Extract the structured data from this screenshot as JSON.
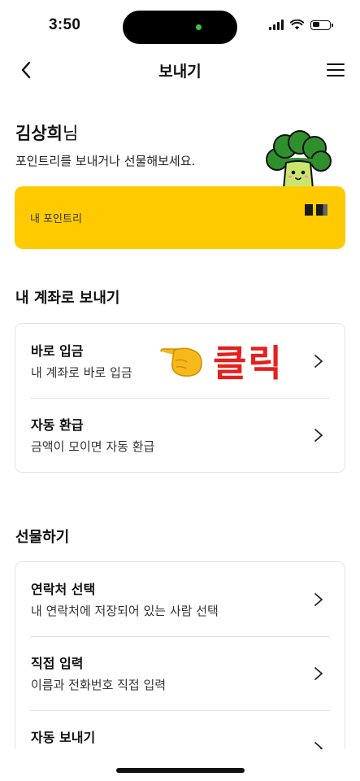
{
  "status_bar": {
    "time": "3:50"
  },
  "nav": {
    "title": "보내기"
  },
  "greeting": {
    "name": "김상희",
    "name_suffix": "님",
    "description": "포인트리를 보내거나 선물해보세요."
  },
  "points_card": {
    "label": "내 포인트리"
  },
  "section_my_account": {
    "title": "내 계좌로 보내기",
    "items": [
      {
        "title": "바로 입금",
        "subtitle": "내 계좌로 바로 입금"
      },
      {
        "title": "자동 환급",
        "subtitle": "금액이 모이면 자동 환급"
      }
    ]
  },
  "section_gift": {
    "title": "선물하기",
    "items": [
      {
        "title": "연락처 선택",
        "subtitle": "내 연락처에 저장되어 있는 사람 선택"
      },
      {
        "title": "직접 입력",
        "subtitle": "이름과 전화번호 직접 입력"
      },
      {
        "title": "자동 보내기",
        "subtitle": ""
      }
    ]
  },
  "annotation": {
    "text": "클릭",
    "icon": "pointing-hand-icon"
  },
  "colors": {
    "accent_yellow": "#ffcb00",
    "annotation_red": "#e5201e",
    "border": "#e3e3e3"
  }
}
